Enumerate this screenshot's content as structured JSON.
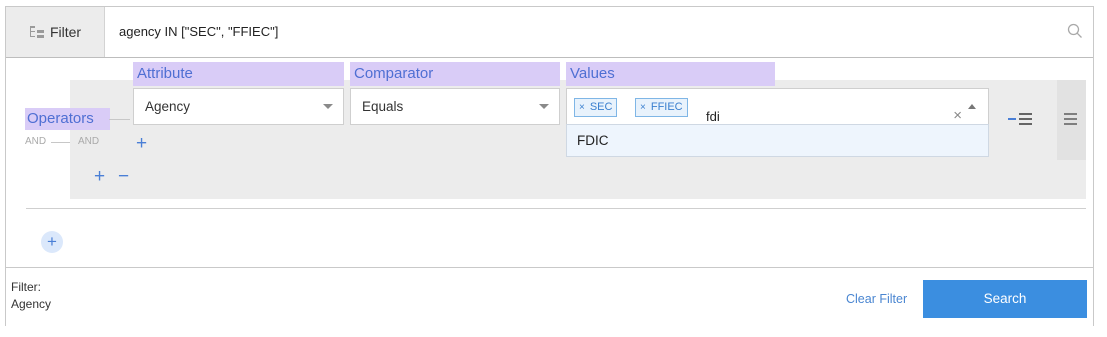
{
  "topbar": {
    "filter_tab_label": "Filter",
    "query": "agency IN [\"SEC\", \"FFIEC\"]"
  },
  "builder": {
    "headers": {
      "attribute": "Attribute",
      "comparator": "Comparator",
      "values": "Values",
      "operators": "Operators"
    },
    "operator_outer": "AND",
    "operator_inner": "AND",
    "row": {
      "attribute": "Agency",
      "comparator": "Equals",
      "tags": [
        "SEC",
        "FFIEC"
      ],
      "tag_remove": "×",
      "typed_value": "fdi",
      "clear_symbol": "×"
    },
    "suggestions": [
      "FDIC"
    ],
    "add_symbol": "+",
    "remove_symbol": "−"
  },
  "footer": {
    "filter_label": "Filter:",
    "filter_value": "Agency",
    "clear_filter": "Clear Filter",
    "search": "Search"
  },
  "colors": {
    "accent": "#3b8ee0",
    "highlight": "#d9ccf7",
    "tag_border": "#7fb6e6"
  }
}
